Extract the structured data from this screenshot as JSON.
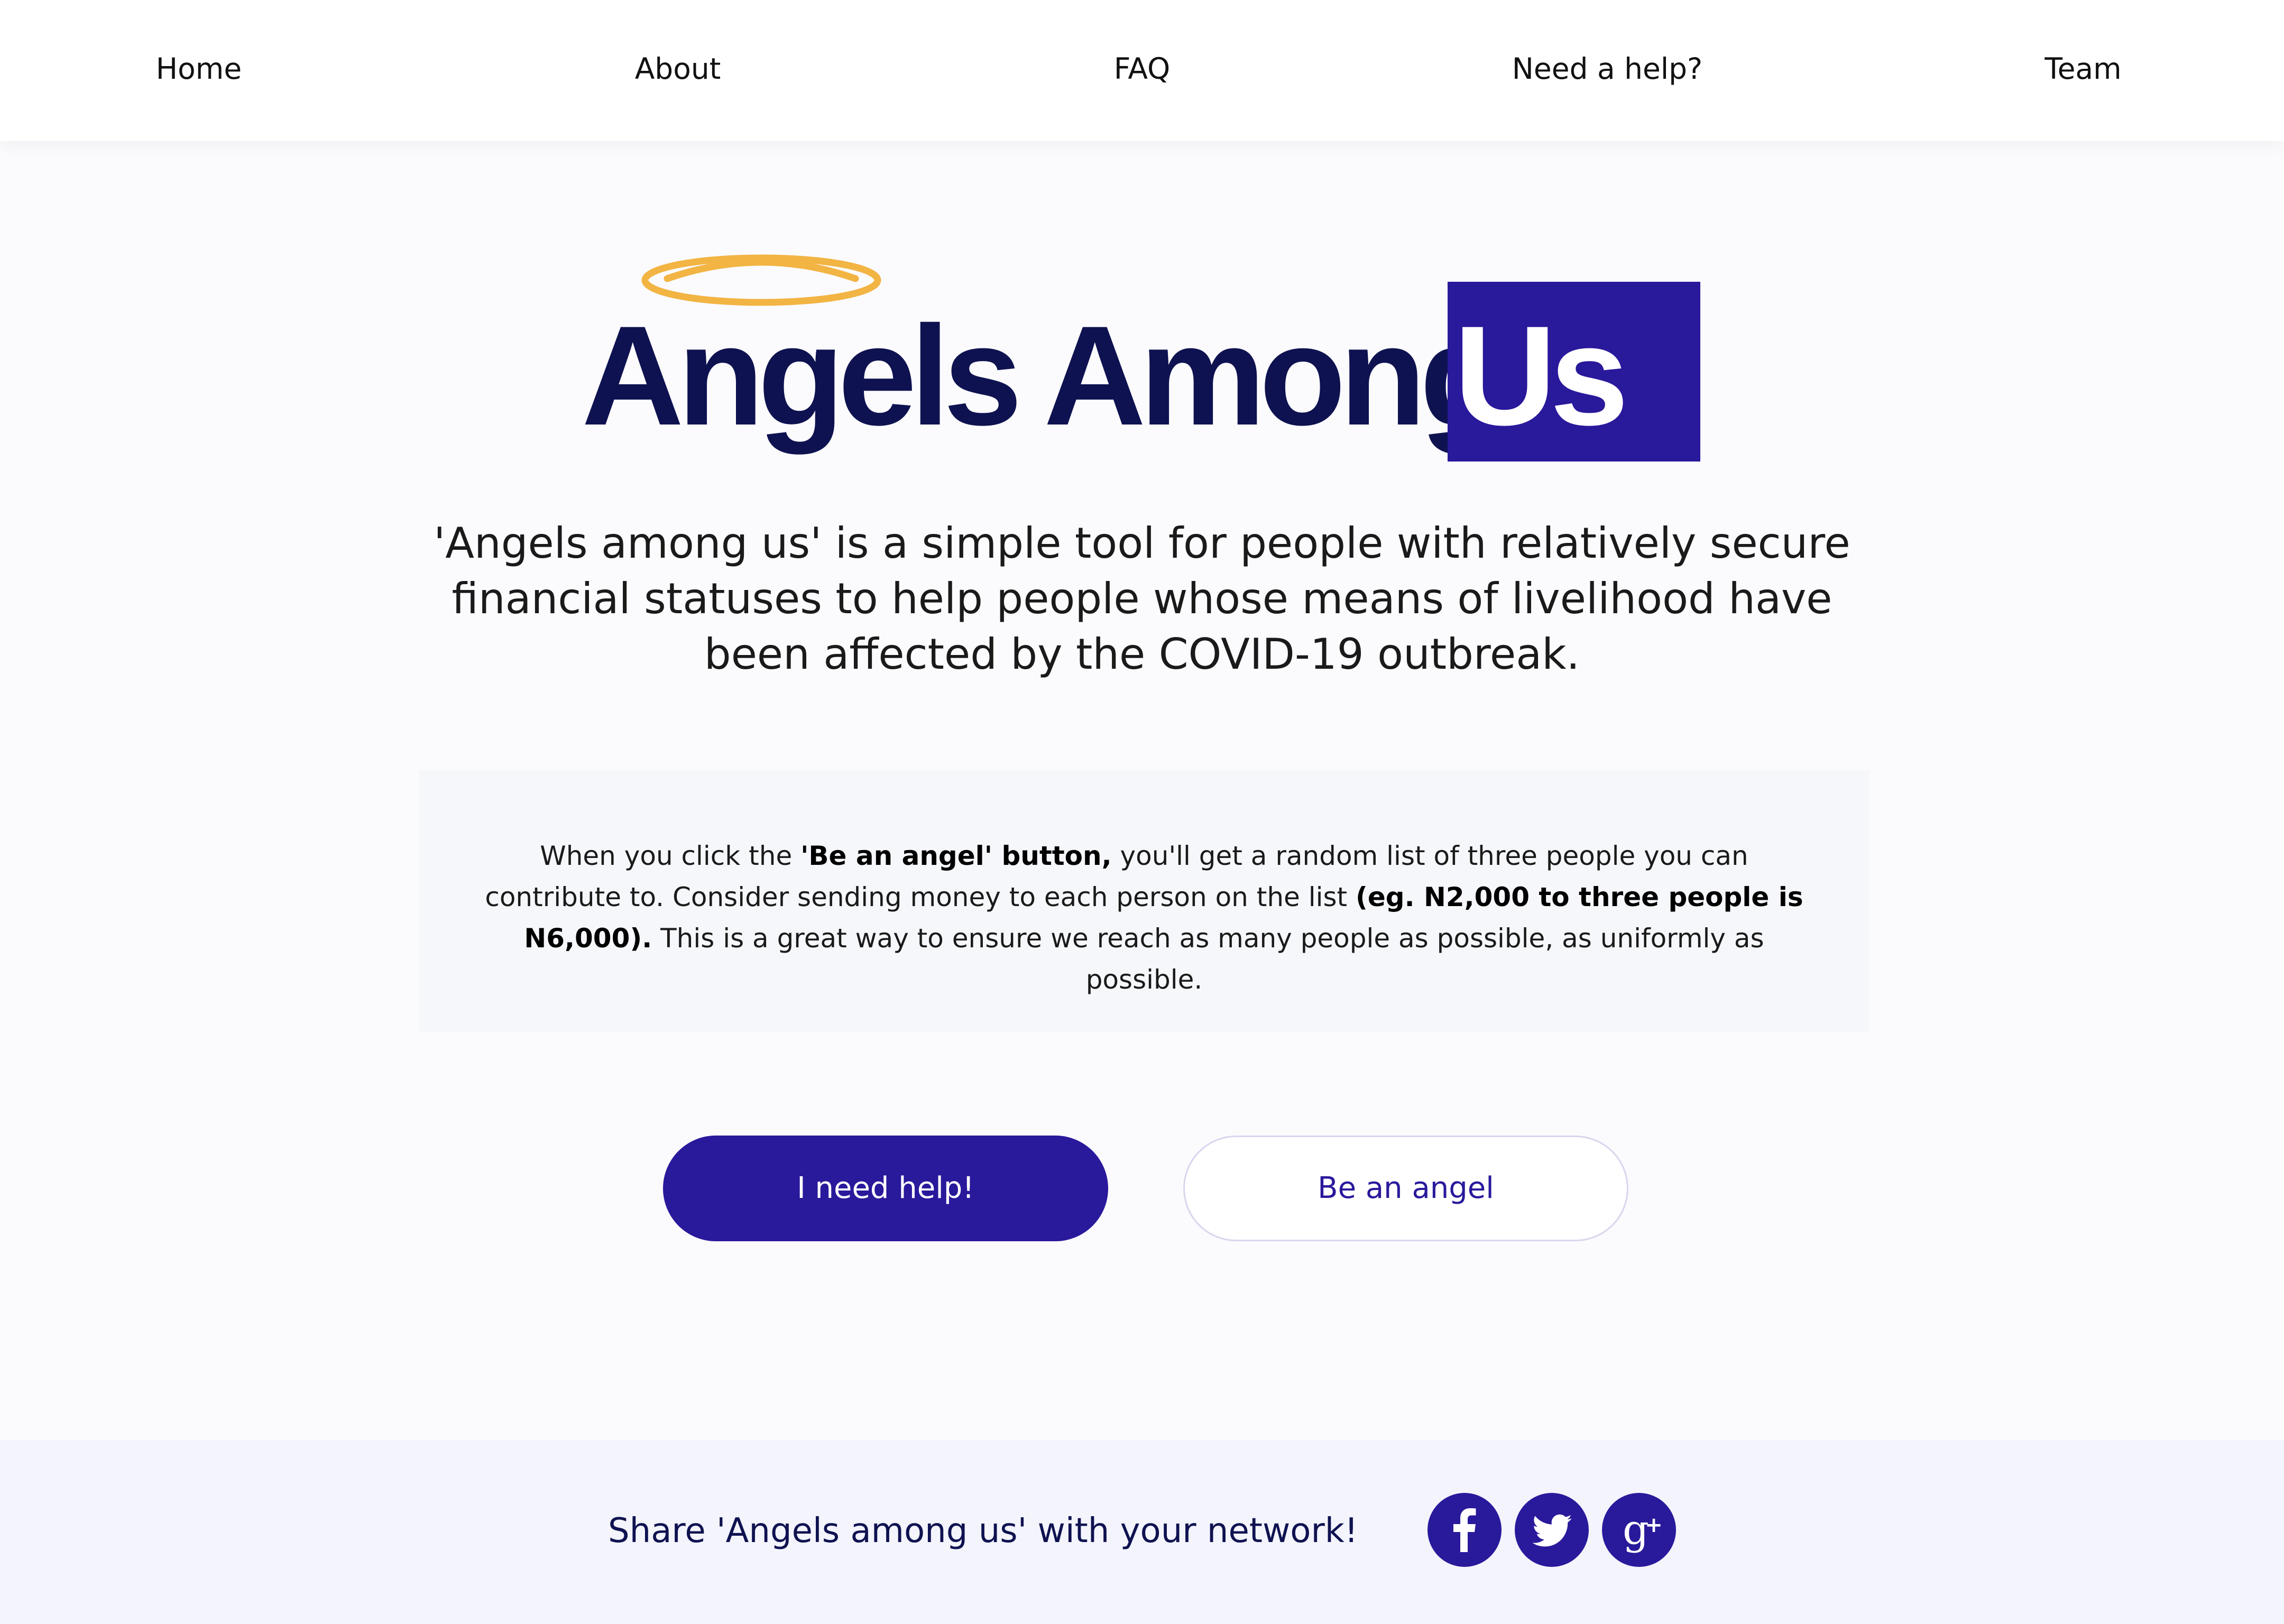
{
  "nav": {
    "items": [
      "Home",
      "About",
      "FAQ",
      "Need a help?",
      "Team"
    ]
  },
  "logo": {
    "text_main": "Angels Among",
    "text_highlight": "Us",
    "colors": {
      "text": "#0f1250",
      "box": "#29199b",
      "halo": "#f2b443"
    }
  },
  "intro": {
    "text": "'Angels among us' is a simple tool for people with relatively secure financial statuses to help people whose means of livelihood have been affected by the COVID-19 outbreak."
  },
  "info": {
    "p1": "When you click the ",
    "b1": "'Be an angel' button,",
    "p2": " you'll get a random list of three people you can contribute to. Consider sending money to each person on the list ",
    "b2": "(eg. N2,000 to three people is N6,000).",
    "p3": " This is a great way to ensure we reach as many people as possible, as uniformly as possible."
  },
  "buttons": {
    "help_label": "I need help!",
    "angel_label": "Be an angel"
  },
  "footer": {
    "share_text": "Share 'Angels among us' with your network!",
    "social_icons": [
      "facebook-icon",
      "twitter-icon",
      "google-plus-icon"
    ]
  },
  "colors": {
    "accent": "#29199b",
    "dark_navy": "#0f1250",
    "background": "#fbfbfe",
    "footer_bg": "#f3f4fc"
  }
}
